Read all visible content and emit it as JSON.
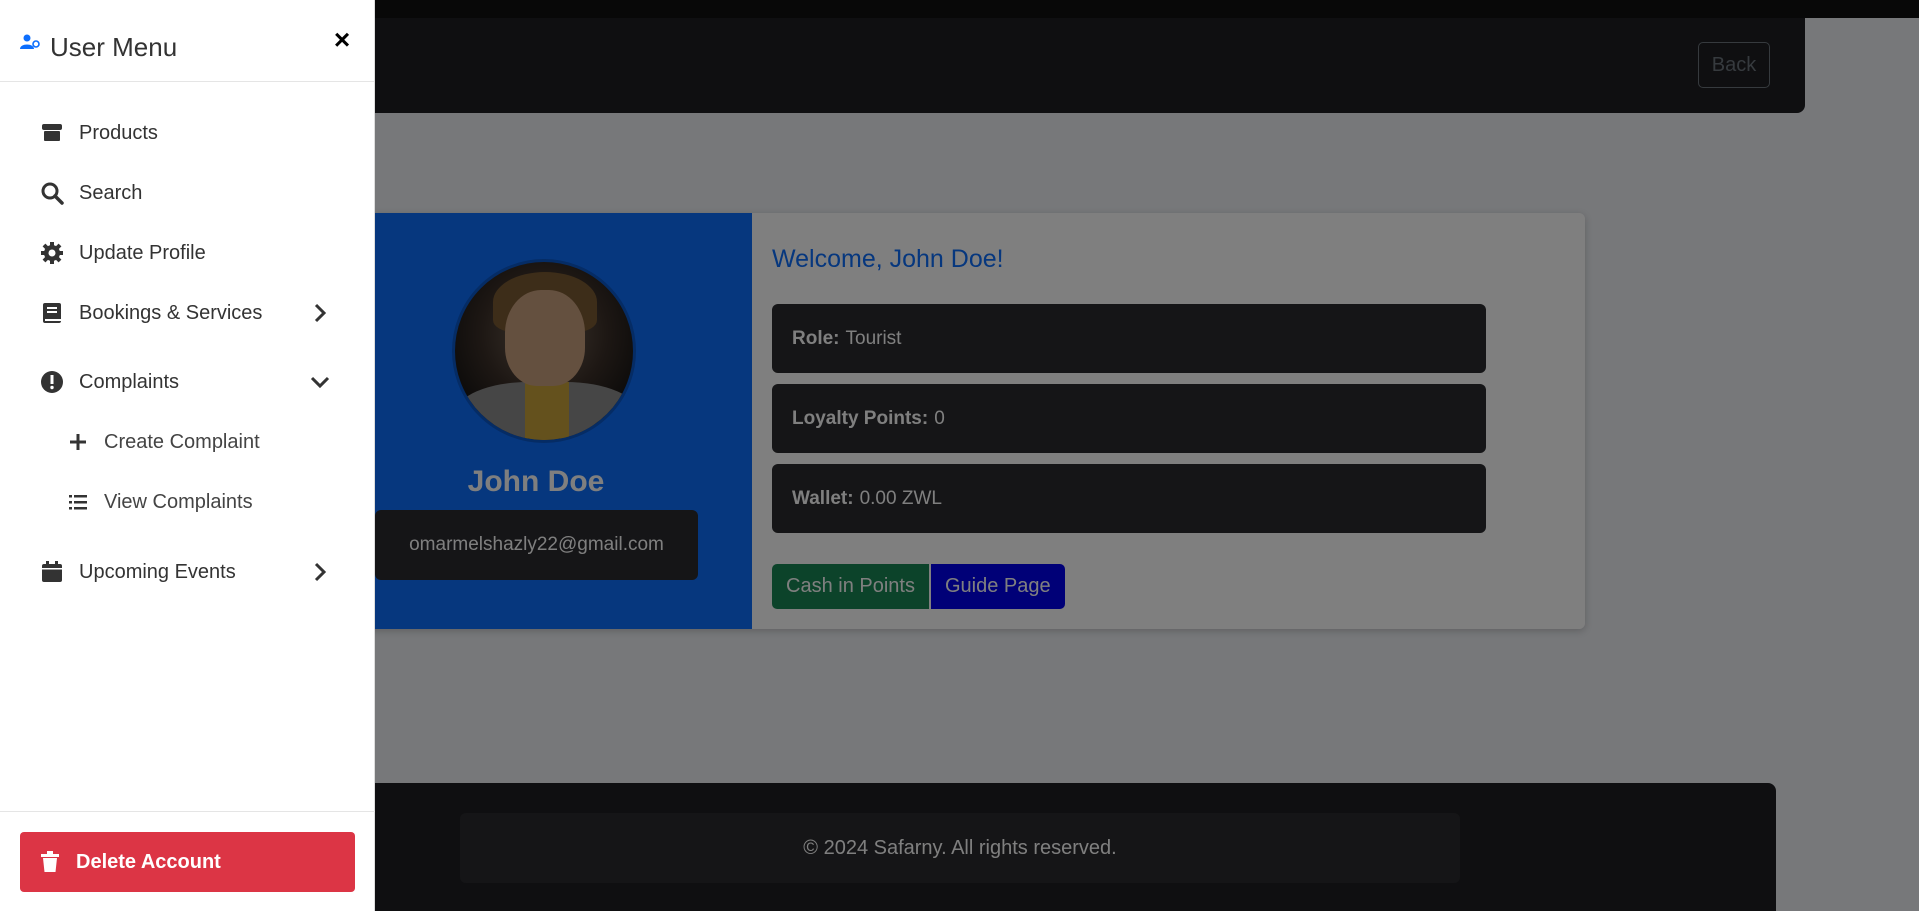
{
  "sidebar": {
    "title": "User Menu",
    "close_glyph": "×",
    "items": [
      {
        "label": "Products",
        "icon": "store-icon"
      },
      {
        "label": "Search",
        "icon": "search-icon"
      },
      {
        "label": "Update Profile",
        "icon": "gear-icon"
      },
      {
        "label": "Bookings & Services",
        "icon": "book-icon",
        "chevron": "chevron-right-icon"
      },
      {
        "label": "Complaints",
        "icon": "exclamation-circle-icon",
        "chevron": "chevron-down-icon",
        "expanded": true
      },
      {
        "label": "Upcoming Events",
        "icon": "calendar-icon",
        "chevron": "chevron-right-icon"
      }
    ],
    "complaints_sub": [
      {
        "label": "Create Complaint",
        "icon": "plus-icon"
      },
      {
        "label": "View Complaints",
        "icon": "list-icon"
      }
    ],
    "delete_label": "Delete Account"
  },
  "navbar": {
    "back_label": "Back"
  },
  "profile": {
    "name": "John Doe",
    "email": "omarmelshazly22@gmail.com",
    "welcome": "Welcome, John Doe!",
    "role_label": "Role:",
    "role_value": "Tourist",
    "loyalty_label": "Loyalty Points:",
    "loyalty_value": "0",
    "wallet_label": "Wallet:",
    "wallet_value": "0.00 ZWL",
    "cash_label": "Cash in Points",
    "guide_label": "Guide Page"
  },
  "footer": {
    "text": "© 2024 Safarny. All rights reserved."
  },
  "colors": {
    "primary": "#0d6efd",
    "danger": "#dc3545",
    "success": "#198754",
    "dark": "#1e1f22"
  }
}
